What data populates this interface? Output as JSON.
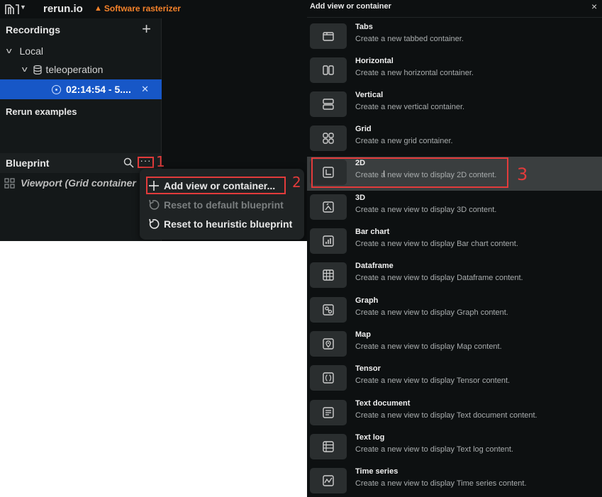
{
  "topbar": {
    "app_name": "rerun.io",
    "warning": "Software rasterizer",
    "icons": [
      "rerun-logo-icon",
      "warning-icon"
    ]
  },
  "recordings": {
    "title": "Recordings",
    "local_label": "Local",
    "app_label": "teleoperation",
    "recording_label": "02:14:54 - 5....",
    "examples_label": "Rerun examples"
  },
  "blueprint": {
    "title": "Blueprint",
    "viewport_label": "Viewport (Grid container"
  },
  "context_menu": {
    "items": [
      {
        "label": "Add view or container...",
        "enabled": true
      },
      {
        "label": "Reset to default blueprint",
        "enabled": false
      },
      {
        "label": "Reset to heuristic blueprint",
        "enabled": true
      }
    ]
  },
  "annotations": {
    "one": "1",
    "two": "2",
    "three": "3",
    "color": "#e23b3b"
  },
  "add_panel": {
    "title": "Add view or container",
    "close": "×",
    "options": [
      {
        "title": "Tabs",
        "desc": "Create a new tabbed container.",
        "icon": "tabs-icon"
      },
      {
        "title": "Horizontal",
        "desc": "Create a new horizontal container.",
        "icon": "horizontal-icon"
      },
      {
        "title": "Vertical",
        "desc": "Create a new vertical container.",
        "icon": "vertical-icon"
      },
      {
        "title": "Grid",
        "desc": "Create a new grid container.",
        "icon": "grid-icon"
      },
      {
        "title": "2D",
        "desc": "Create a new view to display 2D content.",
        "icon": "view-2d-icon"
      },
      {
        "title": "3D",
        "desc": "Create a new view to display 3D content.",
        "icon": "view-3d-icon"
      },
      {
        "title": "Bar chart",
        "desc": "Create a new view to display Bar chart content.",
        "icon": "bar-chart-icon"
      },
      {
        "title": "Dataframe",
        "desc": "Create a new view to display Dataframe content.",
        "icon": "dataframe-icon"
      },
      {
        "title": "Graph",
        "desc": "Create a new view to display Graph content.",
        "icon": "graph-icon"
      },
      {
        "title": "Map",
        "desc": "Create a new view to display Map content.",
        "icon": "map-icon"
      },
      {
        "title": "Tensor",
        "desc": "Create a new view to display Tensor content.",
        "icon": "tensor-icon"
      },
      {
        "title": "Text document",
        "desc": "Create a new view to display Text document content.",
        "icon": "text-document-icon"
      },
      {
        "title": "Text log",
        "desc": "Create a new view to display Text log content.",
        "icon": "text-log-icon"
      },
      {
        "title": "Time series",
        "desc": "Create a new view to display Time series content.",
        "icon": "time-series-icon"
      }
    ]
  },
  "colors": {
    "selection": "#1757c7",
    "warning": "#f5822a",
    "highlight": "#e23b3b"
  }
}
